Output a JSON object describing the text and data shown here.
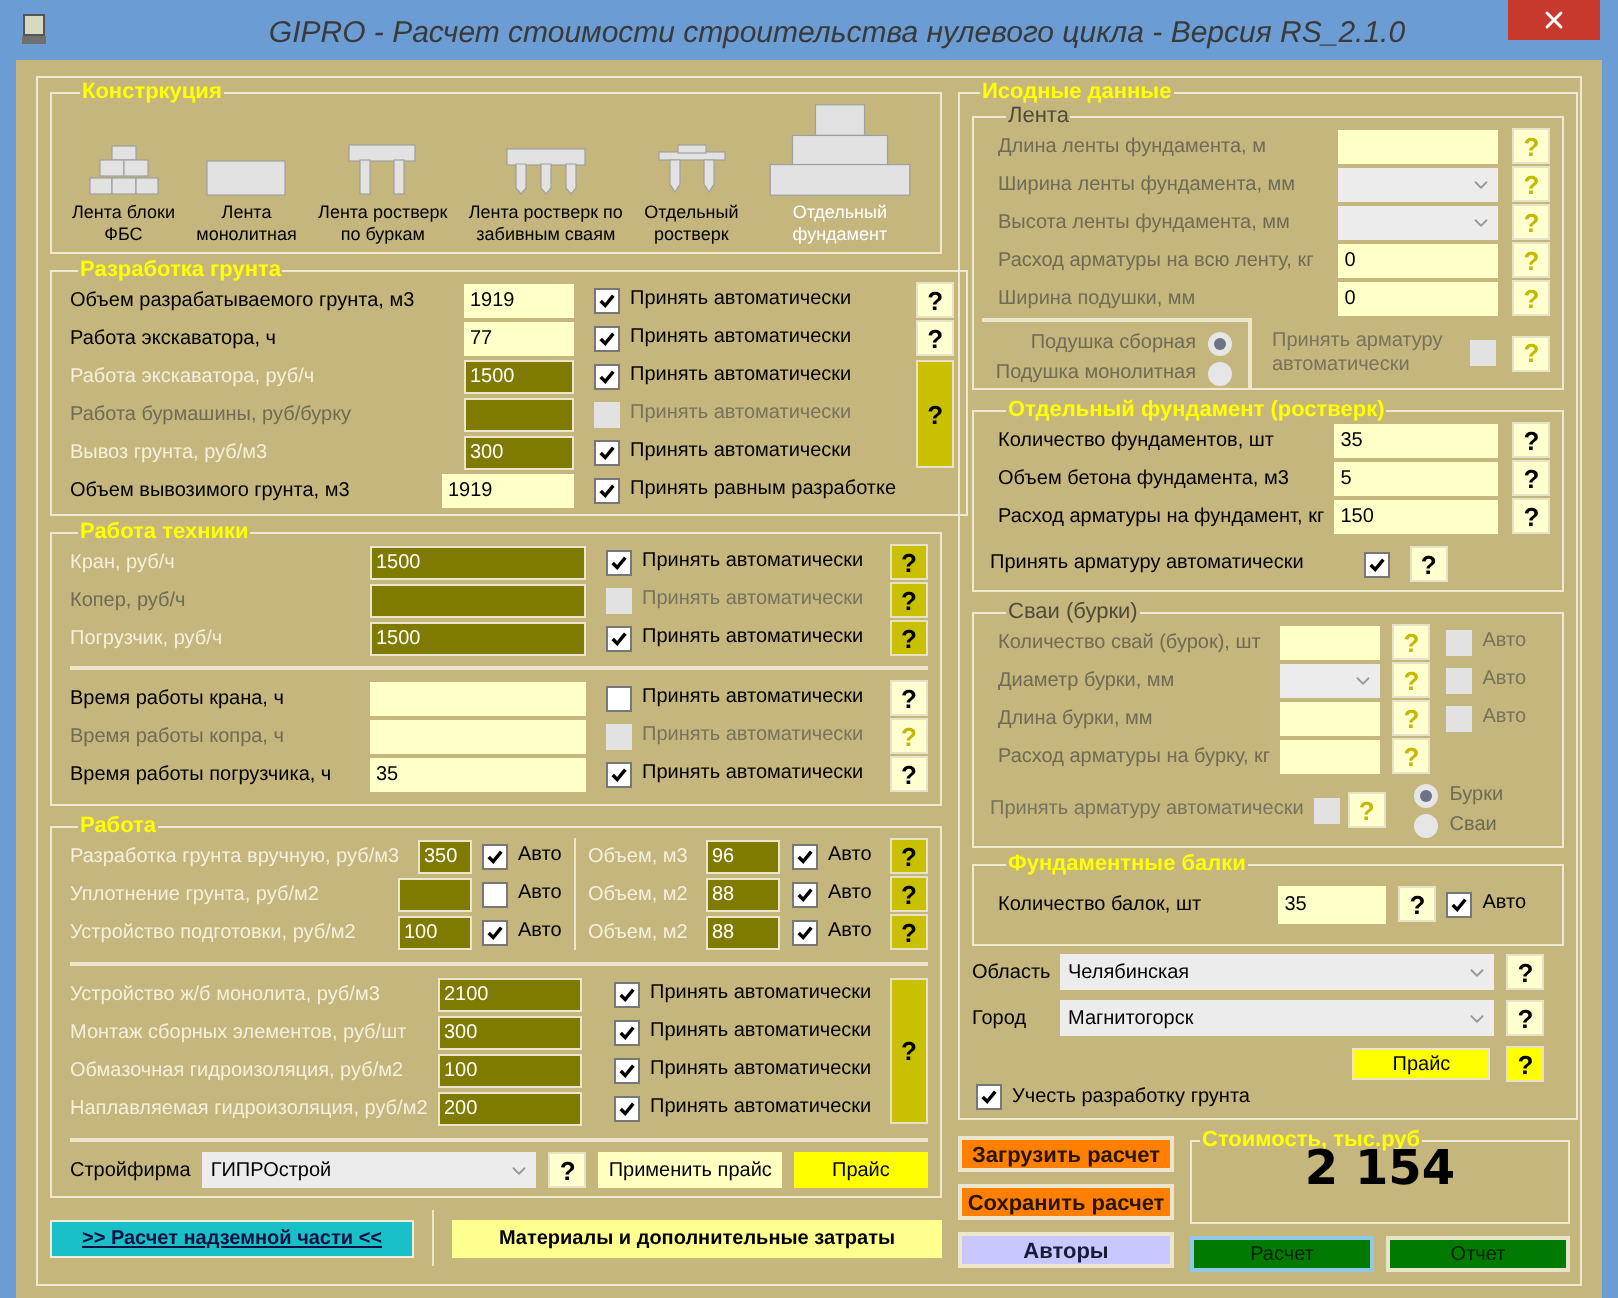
{
  "window": {
    "title": "GIPRO - Расчет стоимости строительства нулевого цикла - Версия RS_2.1.0"
  },
  "construction": {
    "title": "Констркуция",
    "types": [
      {
        "kind": "blocks",
        "label": "Лента блоки\nФБС",
        "selected": false
      },
      {
        "kind": "slab",
        "label": "Лента\nмонолитная",
        "selected": false
      },
      {
        "kind": "bored",
        "label": "Лента ростверк\nпо буркам",
        "selected": false
      },
      {
        "kind": "driven",
        "label": "Лента ростверк по\nзабивным сваям",
        "selected": false
      },
      {
        "kind": "cap",
        "label": "Отдельный\nростверк",
        "selected": false
      },
      {
        "kind": "stepped",
        "label": "Отдельный\nфундамент",
        "selected": true
      }
    ]
  },
  "soil": {
    "title": "Разработка грунта",
    "rows": [
      {
        "label": "Объем разрабатываемого грунта, м3",
        "value": "1919",
        "kind": "light",
        "disabled": false,
        "check": {
          "label": "Принять автоматически",
          "checked": true,
          "disabled": false
        }
      },
      {
        "label": "Работа экскаватора, ч",
        "value": "77",
        "kind": "light",
        "disabled": false,
        "check": {
          "label": "Принять автоматически",
          "checked": true,
          "disabled": false
        }
      },
      {
        "label": "Работа экскаватора, руб/ч",
        "value": "1500",
        "kind": "dark",
        "disabled": false,
        "check": {
          "label": "Принять автоматически",
          "checked": true,
          "disabled": false
        }
      },
      {
        "label": "Работа бурмашины, руб/бурку",
        "kind": "dark",
        "disabled": true,
        "check": {
          "label": "Принять автоматически",
          "checked": false,
          "disabled": true
        }
      },
      {
        "label": "Вывоз грунта, руб/м3",
        "value": "300",
        "kind": "dark",
        "disabled": false,
        "check": {
          "label": "Принять автоматически",
          "checked": true,
          "disabled": false
        }
      },
      {
        "label": "Объем вывозимого грунта, м3",
        "value": "1919",
        "kind": "light",
        "disabled": false,
        "check": {
          "label": "Принять равным разработке",
          "checked": true,
          "disabled": false
        }
      }
    ],
    "help": [
      {
        "label": "?",
        "kind": "light"
      },
      {
        "label": "?",
        "kind": "light"
      },
      {
        "label": "?",
        "kind": "olive"
      }
    ]
  },
  "equipment": {
    "title": "Работа техники",
    "rates": [
      {
        "label": "Кран, руб/ч",
        "value": "1500",
        "kind": "dark",
        "disabled": false,
        "check": {
          "label": "Принять автоматически",
          "checked": true,
          "disabled": false
        },
        "help": {
          "label": "?",
          "kind": "olive"
        }
      },
      {
        "label": "Копер, руб/ч",
        "kind": "dark",
        "disabled": true,
        "check": {
          "label": "Принять автоматически",
          "checked": false,
          "disabled": true
        },
        "help": {
          "label": "?",
          "kind": "olive"
        }
      },
      {
        "label": "Погрузчик, руб/ч",
        "value": "1500",
        "kind": "dark",
        "disabled": false,
        "check": {
          "label": "Принять автоматически",
          "checked": true,
          "disabled": false
        },
        "help": {
          "label": "?",
          "kind": "olive"
        }
      }
    ],
    "hours": [
      {
        "label": "Время работы крана, ч",
        "kind": "light",
        "disabled": false,
        "check": {
          "label": "Принять автоматически",
          "checked": false,
          "disabled": false
        },
        "help": {
          "label": "?",
          "kind": "light"
        }
      },
      {
        "label": "Время работы копра, ч",
        "kind": "light",
        "disabled": true,
        "check": {
          "label": "Принять автоматически",
          "checked": false,
          "disabled": true
        },
        "help": {
          "label": "?",
          "kind": "muted"
        }
      },
      {
        "label": "Время работы погрузчика, ч",
        "value": "35",
        "kind": "light",
        "disabled": false,
        "check": {
          "label": "Принять автоматически",
          "checked": true,
          "disabled": false
        },
        "help": {
          "label": "?",
          "kind": "light"
        }
      }
    ]
  },
  "work": {
    "title": "Работа",
    "manual": [
      {
        "label": "Разработка грунта вручную, руб/м3",
        "value": "350",
        "kind": "dark",
        "disabled": false,
        "check": {
          "label": "Авто",
          "checked": true,
          "disabled": false
        }
      },
      {
        "label": "Уплотнение грунта, руб/м2",
        "kind": "dark",
        "disabled": false,
        "check": {
          "label": "Авто",
          "checked": false,
          "disabled": false
        }
      },
      {
        "label": "Устройство подготовки, руб/м2",
        "value": "100",
        "kind": "dark",
        "disabled": false,
        "check": {
          "label": "Авто",
          "checked": true,
          "disabled": false
        }
      }
    ],
    "volumes": [
      {
        "label": "Объем, м3",
        "value": "96",
        "kind": "dark",
        "disabled": false,
        "check": {
          "label": "Авто",
          "checked": true,
          "disabled": false
        },
        "help": {
          "label": "?",
          "kind": "olive"
        }
      },
      {
        "label": "Объем, м2",
        "value": "88",
        "kind": "dark",
        "disabled": false,
        "check": {
          "label": "Авто",
          "checked": true,
          "disabled": false
        },
        "help": {
          "label": "?",
          "kind": "olive"
        }
      },
      {
        "label": "Объем, м2",
        "value": "88",
        "kind": "dark",
        "disabled": false,
        "check": {
          "label": "Авто",
          "checked": true,
          "disabled": false
        },
        "help": {
          "label": "?",
          "kind": "olive"
        }
      }
    ],
    "monolith": [
      {
        "label": "Устройство ж/б монолита, руб/м3",
        "value": "2100",
        "kind": "dark",
        "disabled": false,
        "check": {
          "label": "Принять автоматически",
          "checked": true,
          "disabled": false
        }
      },
      {
        "label": "Монтаж сборных элементов, руб/шт",
        "value": "300",
        "kind": "dark",
        "disabled": false,
        "check": {
          "label": "Принять автоматически",
          "checked": true,
          "disabled": false
        }
      },
      {
        "label": "Обмазочная гидроизоляция, руб/м2",
        "value": "100",
        "kind": "dark",
        "disabled": false,
        "check": {
          "label": "Принять автоматически",
          "checked": true,
          "disabled": false
        }
      },
      {
        "label": "Наплавляемая гидроизоляция, руб/м2",
        "value": "200",
        "kind": "dark",
        "disabled": false,
        "check": {
          "label": "Принять автоматически",
          "checked": true,
          "disabled": false
        }
      }
    ],
    "monolith_help": {
      "label": "?",
      "kind": "olive"
    },
    "firm": {
      "label": "Стройфирма",
      "value": "ГИПРОстрой",
      "help": {
        "label": "?",
        "kind": "light"
      },
      "apply_button": "Применить прайс",
      "price_button": "Прайс"
    }
  },
  "bottom_buttons": {
    "above_ground": ">> Расчет надземной части <<",
    "materials": "Материалы и дополнительные затраты"
  },
  "source": {
    "title": "Исодные данные",
    "strip": {
      "title": "Лента",
      "disabled": true,
      "rows": [
        {
          "label": "Длина ленты фундамента, м",
          "kind": "light",
          "help": {
            "label": "?",
            "kind": "muted"
          }
        },
        {
          "label": "Ширина ленты фундамента, мм",
          "kind": "select",
          "help": {
            "label": "?",
            "kind": "muted"
          }
        },
        {
          "label": "Высота ленты фундамента, мм",
          "kind": "select",
          "help": {
            "label": "?",
            "kind": "muted"
          }
        },
        {
          "label": "Расход арматуры на всю ленту, кг",
          "value": "0",
          "kind": "light",
          "help": {
            "label": "?",
            "kind": "muted"
          }
        },
        {
          "label": "Ширина подушки, мм",
          "value": "0",
          "kind": "light",
          "help": {
            "label": "?",
            "kind": "muted"
          }
        }
      ],
      "pads": [
        {
          "label": "Подушка сборная",
          "selected": true
        },
        {
          "label": "Подушка монолитная",
          "selected": false
        }
      ],
      "rebar": {
        "label": "Принять арматуру\nавтоматически",
        "checked": false,
        "disabled": true
      },
      "rebar_help": {
        "label": "?",
        "kind": "muted"
      }
    },
    "footing": {
      "title": "Отдельный фундамент (ростверк)",
      "disabled": false,
      "rows": [
        {
          "label": "Количество фундаментов, шт",
          "value": "35",
          "kind": "light",
          "help": {
            "label": "?",
            "kind": "light"
          }
        },
        {
          "label": "Объем бетона фундамента, м3",
          "value": "5",
          "kind": "light",
          "help": {
            "label": "?",
            "kind": "light"
          }
        },
        {
          "label": "Расход арматуры на фундамент, кг",
          "value": "150",
          "kind": "light",
          "help": {
            "label": "?",
            "kind": "light"
          }
        }
      ],
      "rebar": {
        "label": "Принять арматуру автоматически",
        "checked": true,
        "disabled": false
      },
      "rebar_help": {
        "label": "?",
        "kind": "light"
      }
    },
    "piles": {
      "title": "Сваи (бурки)",
      "disabled": true,
      "rows": [
        {
          "label": "Количество свай (бурок), шт",
          "kind": "light",
          "help": {
            "label": "?",
            "kind": "muted"
          },
          "check": {
            "label": "Авто",
            "checked": false,
            "disabled": true
          }
        },
        {
          "label": "Диаметр бурки, мм",
          "kind": "select",
          "help": {
            "label": "?",
            "kind": "muted"
          },
          "check": {
            "label": "Авто",
            "checked": false,
            "disabled": true
          }
        },
        {
          "label": "Длина бурки, мм",
          "kind": "light",
          "help": {
            "label": "?",
            "kind": "muted"
          },
          "check": {
            "label": "Авто",
            "checked": false,
            "disabled": true
          }
        },
        {
          "label": "Расход арматуры на бурку, кг",
          "kind": "light",
          "help": {
            "label": "?",
            "kind": "muted"
          }
        }
      ],
      "rebar": {
        "label": "Принять арматуру автоматически",
        "checked": false,
        "disabled": true
      },
      "rebar_help": {
        "label": "?",
        "kind": "muted"
      },
      "types": [
        {
          "label": "Бурки",
          "selected": true
        },
        {
          "label": "Сваи",
          "selected": false
        }
      ]
    },
    "beams": {
      "title": "Фундаментные балки",
      "disabled": false,
      "rows": [
        {
          "label": "Количество балок, шт",
          "value": "35",
          "kind": "light",
          "help": {
            "label": "?",
            "kind": "light"
          },
          "check": {
            "label": "Авто",
            "checked": true,
            "disabled": false
          }
        }
      ]
    },
    "region": {
      "label": "Область",
      "value": "Челябинская",
      "help": {
        "label": "?",
        "kind": "light"
      }
    },
    "city": {
      "label": "Город",
      "value": "Магнитогорск",
      "help": {
        "label": "?",
        "kind": "light"
      }
    },
    "price_button": "Прайс",
    "price_help": {
      "label": "?",
      "kind": "yellow"
    },
    "soil_toggle": {
      "label": "Учесть разработку грунта",
      "checked": true,
      "disabled": false
    }
  },
  "actions": [
    {
      "label": "Загрузить расчет",
      "kind": "orange"
    },
    {
      "label": "Сохранить расчет",
      "kind": "orange"
    },
    {
      "label": "Авторы",
      "kind": "lavender"
    }
  ],
  "cost": {
    "title": "Стоимость, тыс.руб",
    "value": "2 154"
  },
  "run_buttons": [
    {
      "label": "Расчет",
      "selected": true
    },
    {
      "label": "Отчет",
      "selected": false
    }
  ]
}
